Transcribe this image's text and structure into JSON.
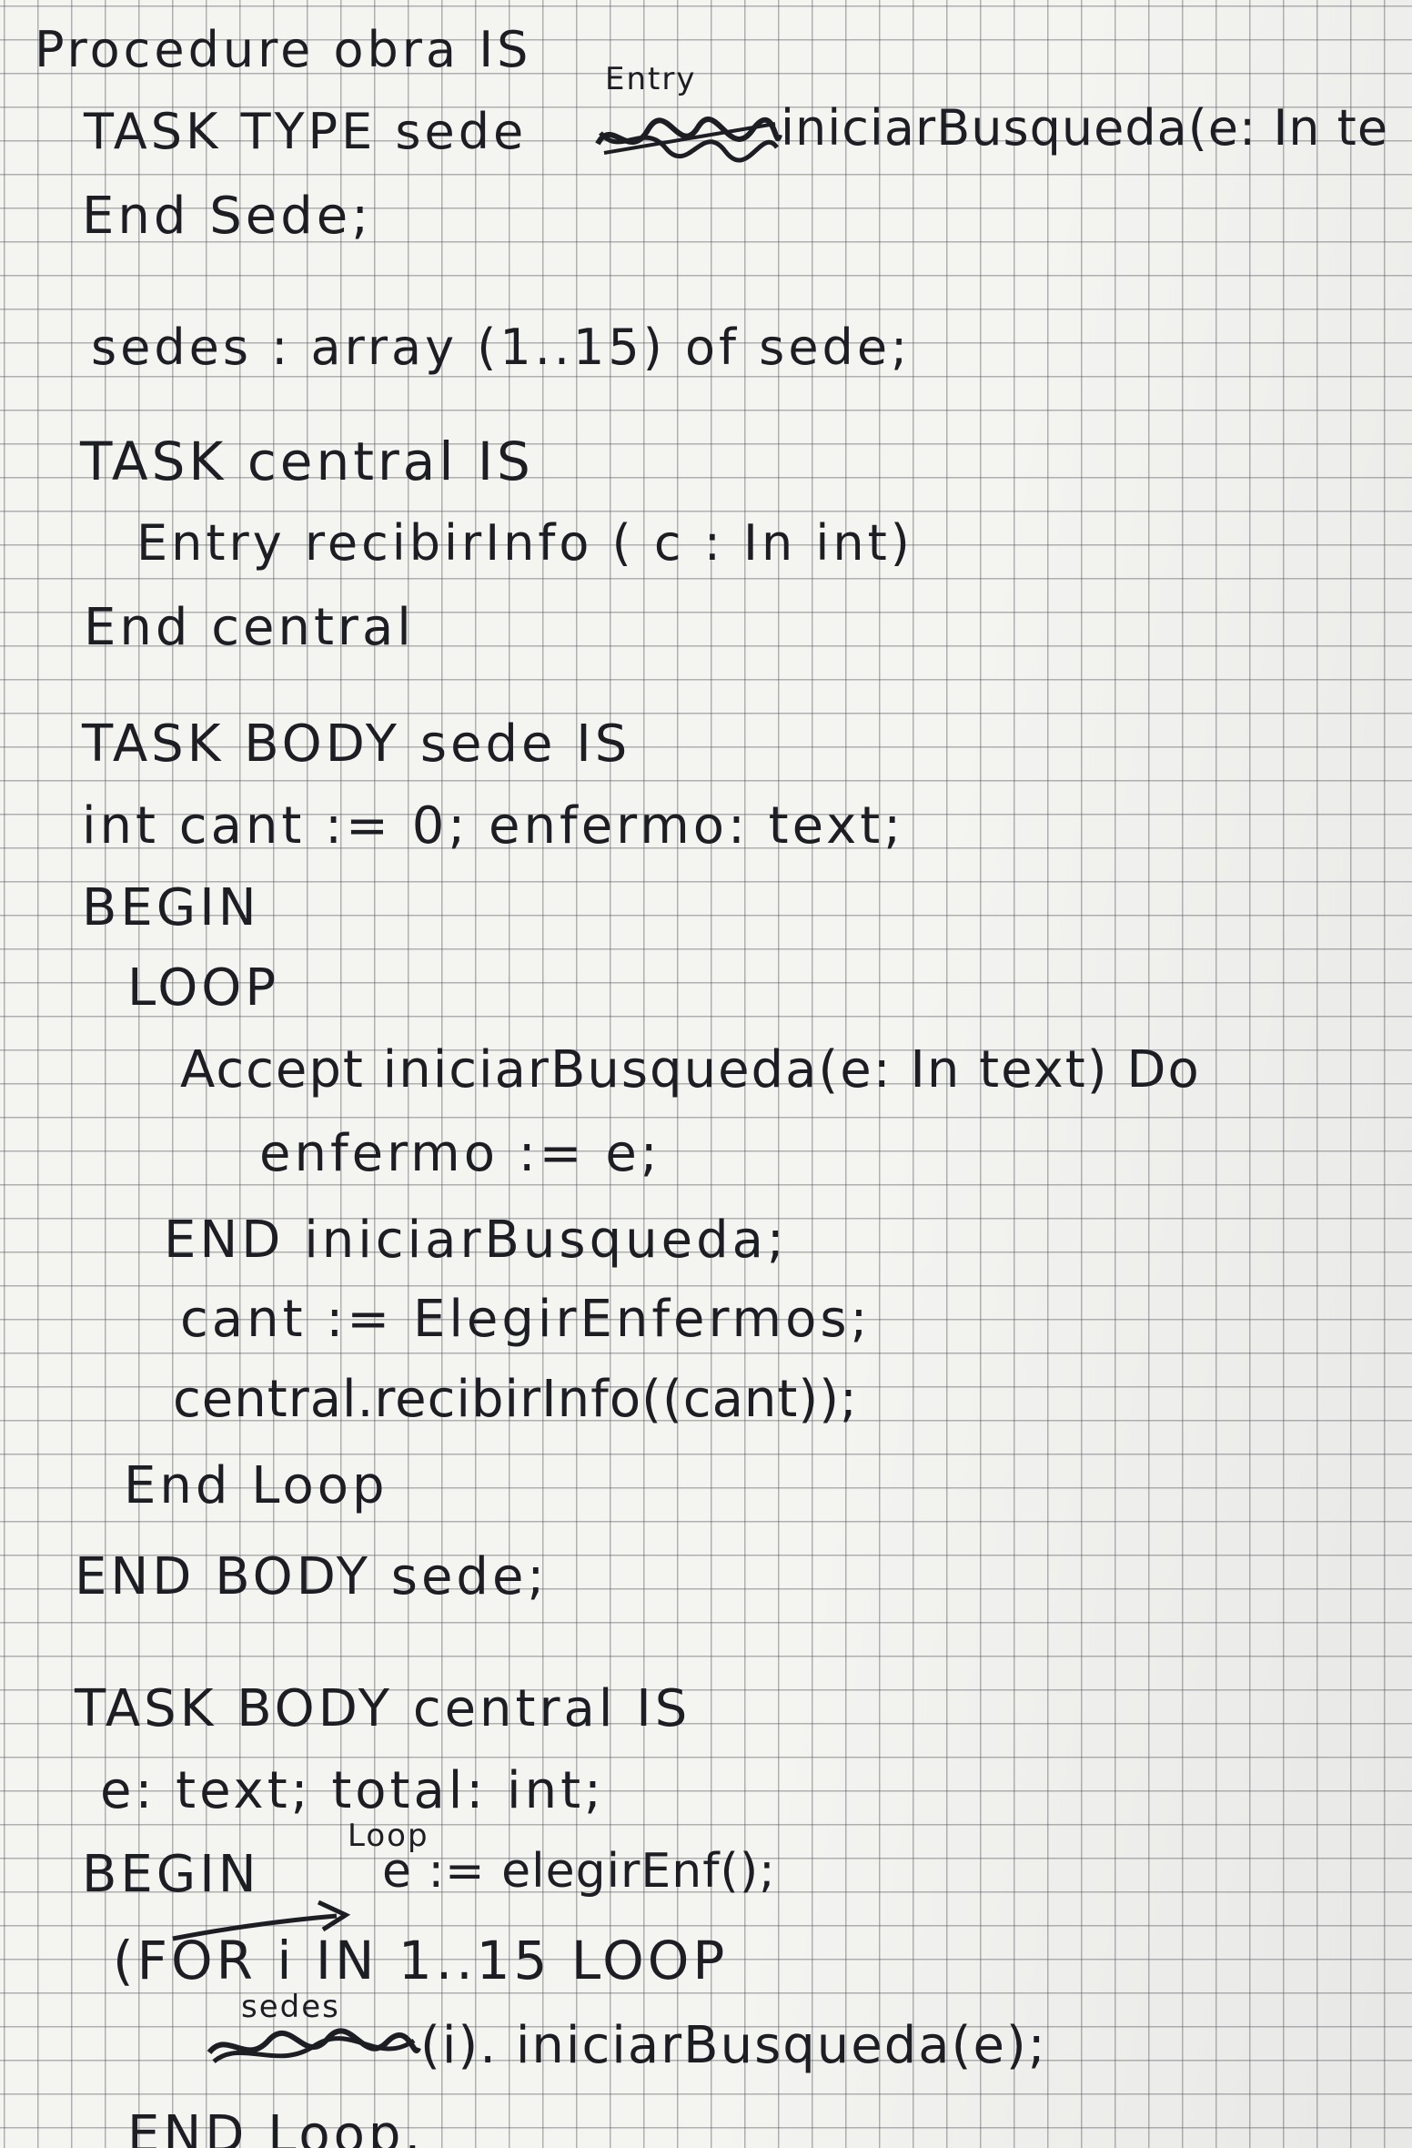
{
  "code": {
    "lines": [
      "Procedure obra IS",
      "TASK TYPE sede",
      "iniciarBusqueda(e: In te",
      "End Sede;",
      "sedes : array (1..15) of sede;",
      "TASK central IS",
      "Entry recibirInfo ( c : In int)",
      "End central",
      "TASK BODY sede IS",
      "int cant := 0; enfermo: text;",
      "BEGIN",
      "LOOP",
      "Accept iniciarBusqueda(e: In text) Do",
      "enfermo := e;",
      "END iniciarBusqueda;",
      "cant := ElegirEnfermos;",
      "central.recibirInfo((cant));",
      "End Loop",
      "END BODY sede;",
      "TASK BODY central IS",
      "e: text; total: int;",
      "BEGIN",
      "e := elegirEnf();",
      "(FOR i IN 1..15 LOOP",
      "(i). iniciarBusqueda(e);",
      "END Loop."
    ],
    "annotations": {
      "entry_above": "Entry",
      "loop_above": "Loop",
      "sedes_above": "sedes"
    }
  }
}
